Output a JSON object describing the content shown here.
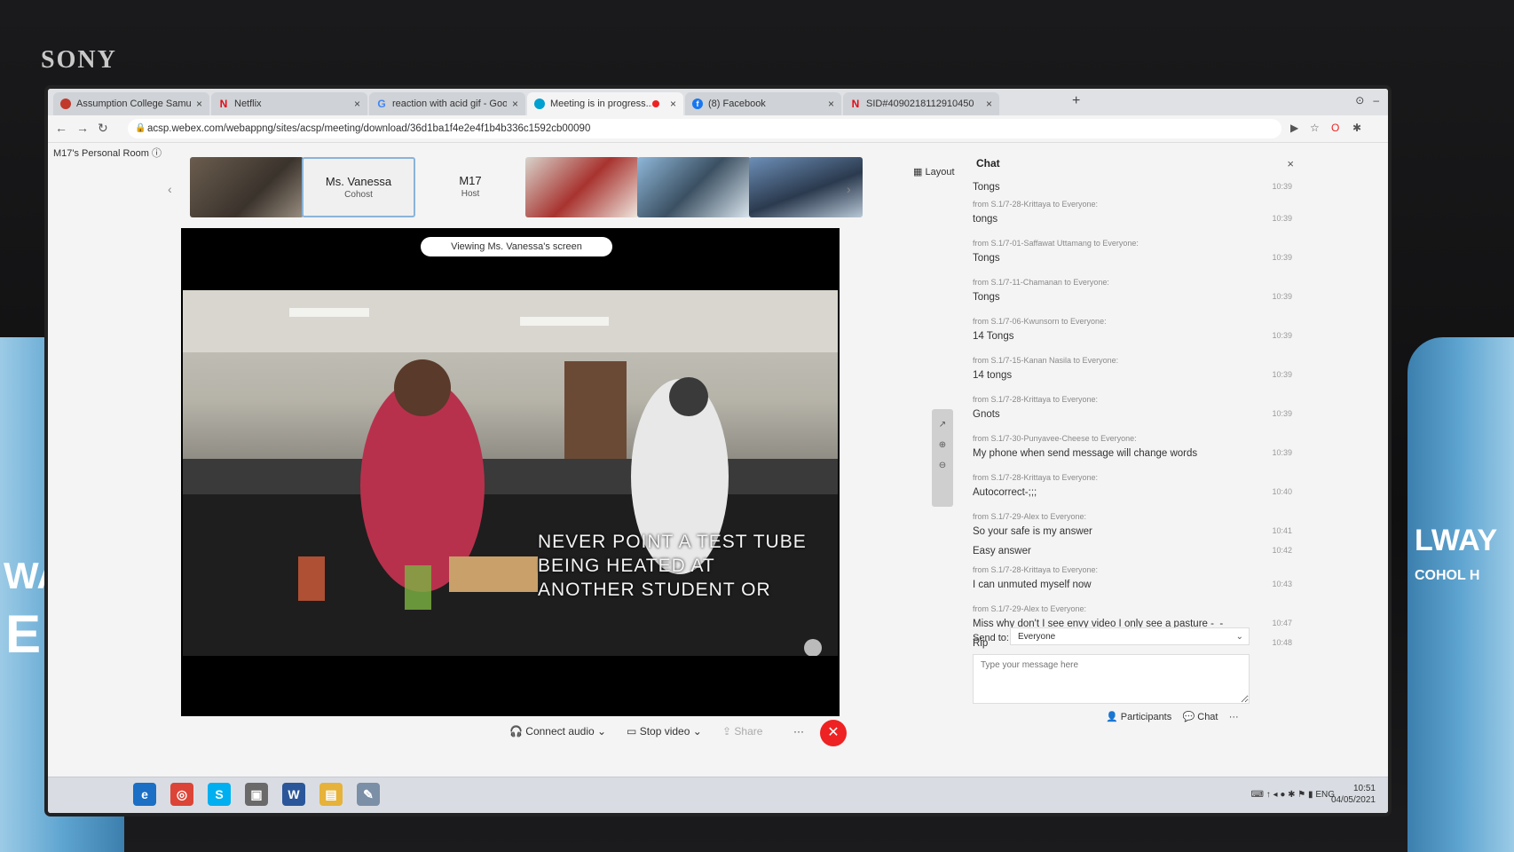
{
  "bezel": {
    "brand": "SONY"
  },
  "bottle_left": {
    "text1": "WAYS",
    "text2": "EL"
  },
  "bottle_right": {
    "text1": "LWAY",
    "text2": "COHOL H"
  },
  "browser": {
    "tabs": [
      {
        "title": "Assumption College Samutprakarn",
        "favicon": "school-icon",
        "color": "#c0392b"
      },
      {
        "title": "Netflix",
        "favicon": "netflix-icon",
        "color": "#e50914"
      },
      {
        "title": "reaction with acid gif - Google S",
        "favicon": "google-icon",
        "color": "#4285f4"
      },
      {
        "title": "Meeting is in progress...",
        "favicon": "webex-icon",
        "color": "#00a0d1"
      },
      {
        "title": "(8) Facebook",
        "favicon": "facebook-icon",
        "color": "#1877f2"
      },
      {
        "title": "SID#4090218112910450",
        "favicon": "netflix-icon",
        "color": "#e50914"
      }
    ],
    "new_tab": "+",
    "url": "acsp.webex.com/webappng/sites/acsp/meeting/download/36d1ba1f4e2e4f1b4b336c1592cb00090"
  },
  "webex": {
    "room_title": "M17's Personal Room",
    "layout_label": "Layout",
    "participants": [
      {
        "type": "video"
      },
      {
        "type": "tile",
        "name": "Ms. Vanessa",
        "role": "Cohost"
      },
      {
        "type": "tile",
        "name": "M17",
        "role": "Host"
      },
      {
        "type": "video"
      },
      {
        "type": "video"
      },
      {
        "type": "video"
      }
    ],
    "viewing_label": "Viewing Ms. Vanessa's screen",
    "video_caption": [
      "NEVER POINT A TEST TUBE",
      "BEING HEATED AT",
      "ANOTHER STUDENT OR"
    ],
    "controls": {
      "connect_audio": "Connect audio",
      "stop_video": "Stop video",
      "share": "Share",
      "more": "···"
    },
    "chat": {
      "title": "Chat",
      "messages": [
        {
          "from": "",
          "text": "Tongs",
          "time": "10:39"
        },
        {
          "from": "from S.1/7-28-Krittaya to Everyone:",
          "text": "tongs",
          "time": "10:39"
        },
        {
          "from": "from S.1/7-01-Saffawat Uttamang to Everyone:",
          "text": "Tongs",
          "time": "10:39"
        },
        {
          "from": "from S.1/7-11-Chamanan to Everyone:",
          "text": "Tongs",
          "time": "10:39"
        },
        {
          "from": "from S.1/7-06-Kwunsorn to Everyone:",
          "text": "14 Tongs",
          "time": "10:39"
        },
        {
          "from": "from S.1/7-15-Kanan Nasila to Everyone:",
          "text": "14 tongs",
          "time": "10:39"
        },
        {
          "from": "from S.1/7-28-Krittaya to Everyone:",
          "text": "Gnots",
          "time": "10:39"
        },
        {
          "from": "from S.1/7-30-Punyavee-Cheese to Everyone:",
          "text": "My phone when send message will change words",
          "time": "10:39"
        },
        {
          "from": "from S.1/7-28-Krittaya to Everyone:",
          "text": "Autocorrect-;;;",
          "time": "10:40"
        },
        {
          "from": "from S.1/7-29-Alex to Everyone:",
          "text": "So your safe is my answer",
          "time": "10:41"
        },
        {
          "from": "",
          "text": "Easy answer",
          "time": "10:42"
        },
        {
          "from": "from S.1/7-28-Krittaya to Everyone:",
          "text": "I can unmuted myself now",
          "time": "10:43"
        },
        {
          "from": "from S.1/7-29-Alex to Everyone:",
          "text": "Miss why don't I see envy video I only see a pasture -_-",
          "time": "10:47"
        },
        {
          "from": "",
          "text": "Rip",
          "time": "10:48"
        }
      ],
      "send_to_label": "Send to:",
      "send_to_value": "Everyone",
      "placeholder": "Type your message here",
      "participants_btn": "Participants",
      "chat_btn": "Chat"
    }
  },
  "taskbar": {
    "apps": [
      "ie-icon",
      "chrome-icon",
      "skype-icon",
      "app-icon",
      "word-icon",
      "explorer-icon",
      "paint-icon"
    ],
    "language": "ENG",
    "time": "10:51",
    "date": "04/05/2021"
  }
}
